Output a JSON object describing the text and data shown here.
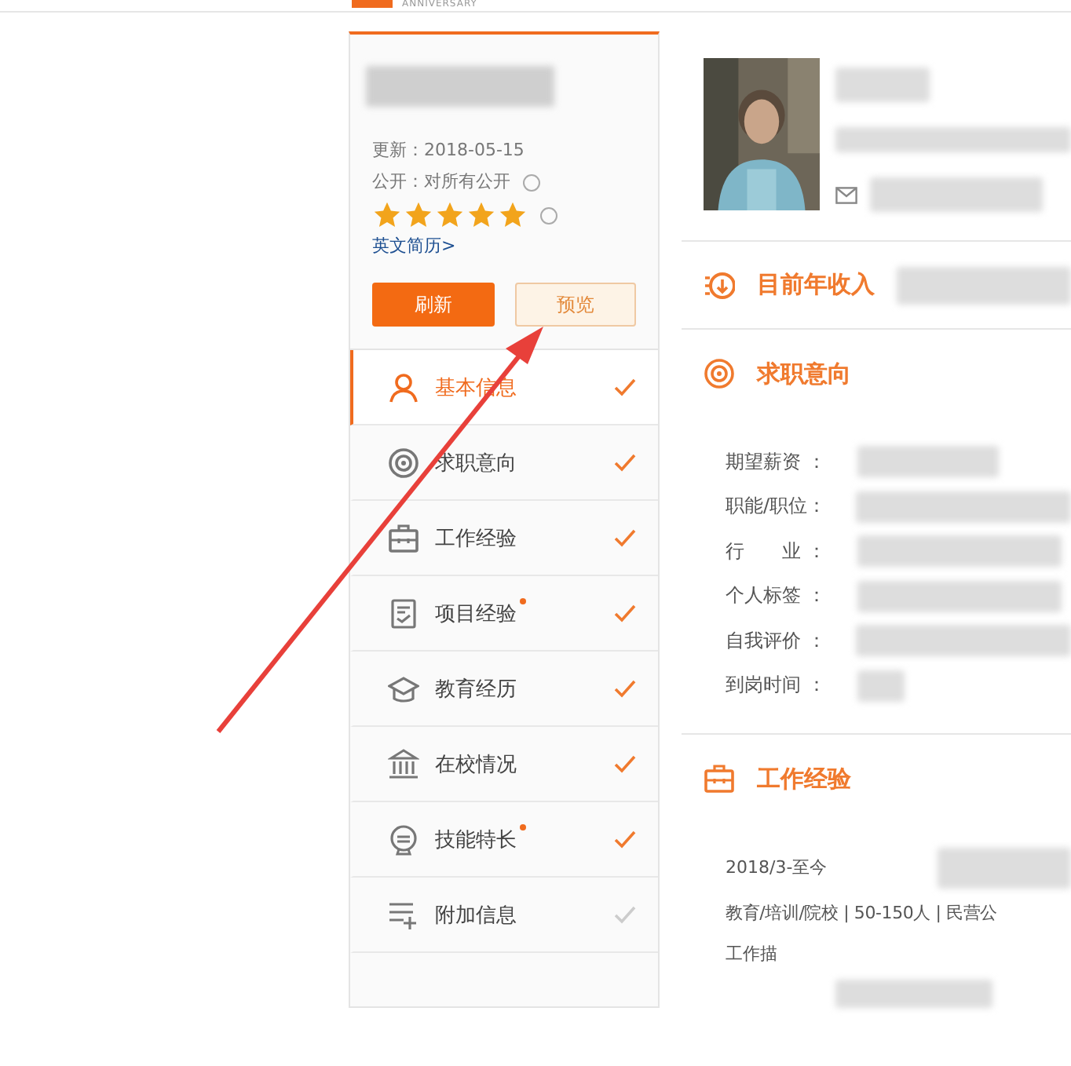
{
  "header": {
    "logo_text": "ANNIVERSARY"
  },
  "profile": {
    "updated": "更新：2018-05-15",
    "visibility": "公开：对所有公开",
    "stars": 5,
    "english_link": "英文简历>",
    "buttons": [
      {
        "label": "刷新",
        "kind": "primary"
      },
      {
        "label": "预览",
        "kind": "secondary"
      }
    ]
  },
  "nav": [
    {
      "label": "基本信息",
      "selected": true,
      "done": true,
      "badge": false
    },
    {
      "label": "求职意向",
      "selected": false,
      "done": true,
      "badge": false
    },
    {
      "label": "工作经验",
      "selected": false,
      "done": true,
      "badge": false
    },
    {
      "label": "项目经验",
      "selected": false,
      "done": true,
      "badge": true
    },
    {
      "label": "教育经历",
      "selected": false,
      "done": true,
      "badge": false
    },
    {
      "label": "在校情况",
      "selected": false,
      "done": true,
      "badge": false
    },
    {
      "label": "技能特长",
      "selected": false,
      "done": true,
      "badge": true
    },
    {
      "label": "附加信息",
      "selected": false,
      "done": false,
      "badge": false
    }
  ],
  "sections": [
    {
      "kind": "income",
      "title": "目前年收入"
    },
    {
      "kind": "fields",
      "title": "求职意向",
      "fields": [
        "期望薪资 ：",
        "职能/职位：",
        "行　　业 ：",
        "个人标签 ：",
        "自我评价 ：",
        "到岗时间 ："
      ]
    },
    {
      "kind": "work",
      "title": "工作经验",
      "period": "2018/3-至今",
      "details": "教育/培训/院校 | 50-150人 | 民营公",
      "description": "工作描"
    }
  ],
  "annotation": {
    "kind": "arrow"
  }
}
